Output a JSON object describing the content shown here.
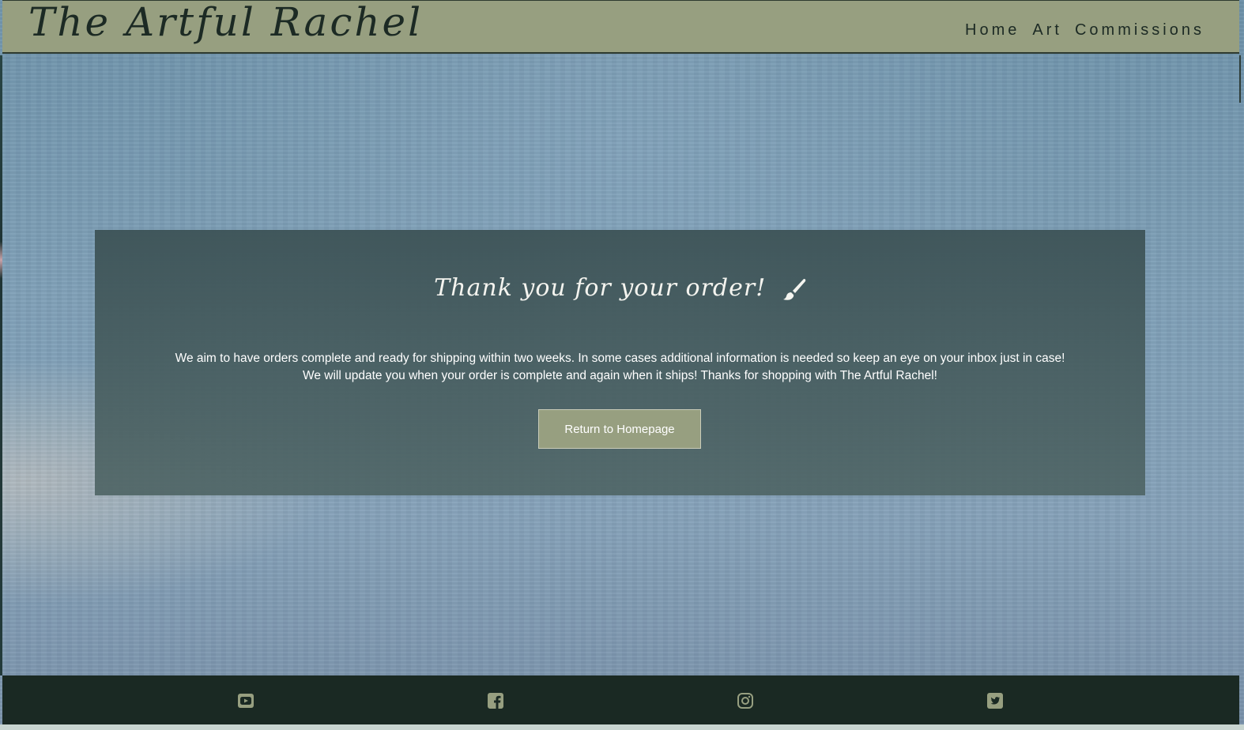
{
  "header": {
    "brand": "The Artful Rachel",
    "nav": [
      "Home",
      "Art",
      "Commissions"
    ]
  },
  "main": {
    "title": "Thank you for your order!",
    "title_icon": "paintbrush-icon",
    "message": "We aim to have orders complete and ready for shipping within two weeks. In some cases additional information is needed so keep an eye on your inbox just in case! We will update you when your order is complete and again when it ships! Thanks for shopping with The Artful Rachel!",
    "button_label": "Return to Homepage"
  },
  "footer": {
    "icons": [
      "youtube-icon",
      "facebook-icon",
      "instagram-icon",
      "twitter-icon"
    ]
  },
  "colors": {
    "header_bg": "#979f80",
    "panel_bg": "#3e5458",
    "footer_bg": "#1a2923",
    "button_bg": "#979f80",
    "icon_color": "#979f80"
  }
}
